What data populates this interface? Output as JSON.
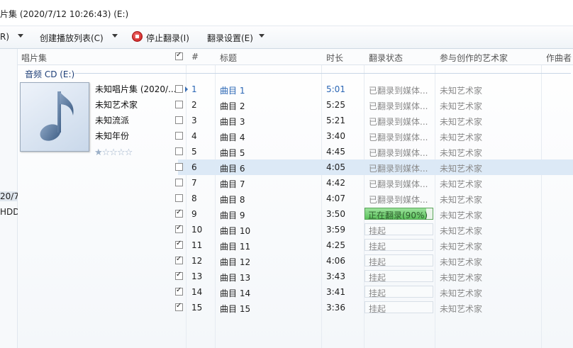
{
  "window": {
    "title": "片集 (2020/7/12 10:26:43) (E:)"
  },
  "toolbar": {
    "item0": "R)",
    "create_playlist": "创建播放列表(C)",
    "stop_rip": "停止翻录(I)",
    "rip_settings": "翻录设置(E)"
  },
  "nav": {
    "item1": "20/7",
    "item2": "HDD"
  },
  "columns": {
    "album": "唱片集",
    "num": "#",
    "title": "标题",
    "length": "时长",
    "rip_status": "翻录状态",
    "artists": "参与创作的艺术家",
    "composer": "作曲者"
  },
  "group": {
    "label": "音频 CD (E:)"
  },
  "album": {
    "name": "未知唱片集 (2020/...",
    "artist": "未知艺术家",
    "genre": "未知流派",
    "year": "未知年份",
    "rating": 1,
    "stars": "★☆☆☆☆"
  },
  "tracks": [
    {
      "num": "1",
      "title": "曲目 1",
      "length": "5:01",
      "status": "已翻录到媒体...",
      "artist": "未知艺术家",
      "checked": false
    },
    {
      "num": "2",
      "title": "曲目 2",
      "length": "5:25",
      "status": "已翻录到媒体...",
      "artist": "未知艺术家",
      "checked": false
    },
    {
      "num": "3",
      "title": "曲目 3",
      "length": "5:21",
      "status": "已翻录到媒体...",
      "artist": "未知艺术家",
      "checked": false
    },
    {
      "num": "4",
      "title": "曲目 4",
      "length": "3:40",
      "status": "已翻录到媒体...",
      "artist": "未知艺术家",
      "checked": false
    },
    {
      "num": "5",
      "title": "曲目 5",
      "length": "4:45",
      "status": "已翻录到媒体...",
      "artist": "未知艺术家",
      "checked": false
    },
    {
      "num": "6",
      "title": "曲目 6",
      "length": "4:05",
      "status": "已翻录到媒体...",
      "artist": "未知艺术家",
      "checked": false
    },
    {
      "num": "7",
      "title": "曲目 7",
      "length": "4:42",
      "status": "已翻录到媒体...",
      "artist": "未知艺术家",
      "checked": false
    },
    {
      "num": "8",
      "title": "曲目 8",
      "length": "4:07",
      "status": "已翻录到媒体...",
      "artist": "未知艺术家",
      "checked": false
    },
    {
      "num": "9",
      "title": "曲目 9",
      "length": "3:50",
      "status": "正在翻录(90%)",
      "progress": 0.9,
      "artist": "未知艺术家",
      "checked": true
    },
    {
      "num": "10",
      "title": "曲目 10",
      "length": "3:59",
      "status": "挂起",
      "artist": "未知艺术家",
      "checked": true
    },
    {
      "num": "11",
      "title": "曲目 11",
      "length": "4:25",
      "status": "挂起",
      "artist": "未知艺术家",
      "checked": true
    },
    {
      "num": "12",
      "title": "曲目 12",
      "length": "4:06",
      "status": "挂起",
      "artist": "未知艺术家",
      "checked": true
    },
    {
      "num": "13",
      "title": "曲目 13",
      "length": "3:43",
      "status": "挂起",
      "artist": "未知艺术家",
      "checked": true
    },
    {
      "num": "14",
      "title": "曲目 14",
      "length": "3:41",
      "status": "挂起",
      "artist": "未知艺术家",
      "checked": true
    },
    {
      "num": "15",
      "title": "曲目 15",
      "length": "3:36",
      "status": "挂起",
      "artist": "未知艺术家",
      "checked": true
    }
  ]
}
